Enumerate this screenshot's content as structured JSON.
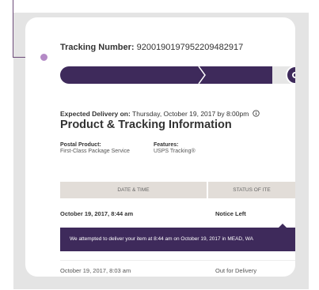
{
  "tracking": {
    "label": "Tracking Number:",
    "number": "9200190197952209482917"
  },
  "progress": {
    "fraction": 0.9
  },
  "delivery": {
    "expected_label": "Expected Delivery on:",
    "expected_value": "Thursday, October 19, 2017 by 8:00pm",
    "info_icon": "info-icon"
  },
  "section_title": "Product & Tracking Information",
  "product": {
    "postal_label": "Postal Product:",
    "postal_value": "First-Class Package Service",
    "features_label": "Features:",
    "features_value": "USPS Tracking®"
  },
  "table": {
    "headers": [
      "DATE & TIME",
      "STATUS OF ITE"
    ],
    "rows": [
      {
        "date": "October 19, 2017, 8:44 am",
        "status": "Notice Left"
      },
      {
        "date": "October 19, 2017, 8:03 am",
        "status": "Out for Delivery"
      }
    ],
    "message": "We attempted to deliver your item at 8:44 am on October 19, 2017 in MEAD, WA"
  },
  "colors": {
    "brand_purple": "#3e2a5b",
    "accent_lilac": "#b48ac6",
    "frame_gray": "#e4e4e4"
  }
}
